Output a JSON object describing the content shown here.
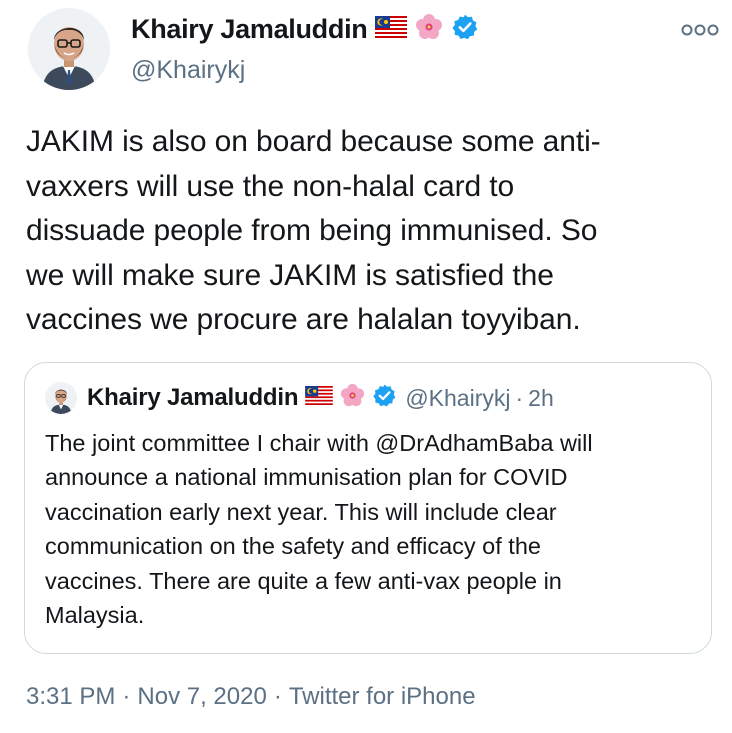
{
  "author": {
    "display_name": "Khairy Jamaluddin",
    "handle": "@Khairykj",
    "avatar_icon": "cartoon-avatar-icon",
    "badges": [
      "malaysia-flag-icon",
      "hibiscus-icon",
      "verified-icon"
    ]
  },
  "more_icon": "more-dots-icon",
  "tweet": {
    "text": "JAKIM is also on board because some anti-\nvaxxers will use the non-halal card to\ndissuade people from being immunised. So\nwe will make sure JAKIM is satisfied the\nvaccines we procure are halalan toyyiban."
  },
  "quoted": {
    "display_name": "Khairy Jamaluddin",
    "handle": "@Khairykj",
    "dot": "·",
    "time": "2h",
    "text": "The joint committee I chair with @DrAdhamBaba will\nannounce a national immunisation plan for COVID\nvaccination early next year. This will include clear\ncommunication on the safety and efficacy of the\nvaccines. There are quite a few anti-vax people in\nMalaysia."
  },
  "footer": {
    "time": "3:31 PM",
    "sep1": "·",
    "date": "Nov 7, 2020",
    "sep2": "·",
    "source": "Twitter for iPhone"
  },
  "colors": {
    "text_primary": "#14171a",
    "text_secondary": "#5b7083",
    "verified_blue": "#1da1f2",
    "border": "#cfd9de"
  }
}
